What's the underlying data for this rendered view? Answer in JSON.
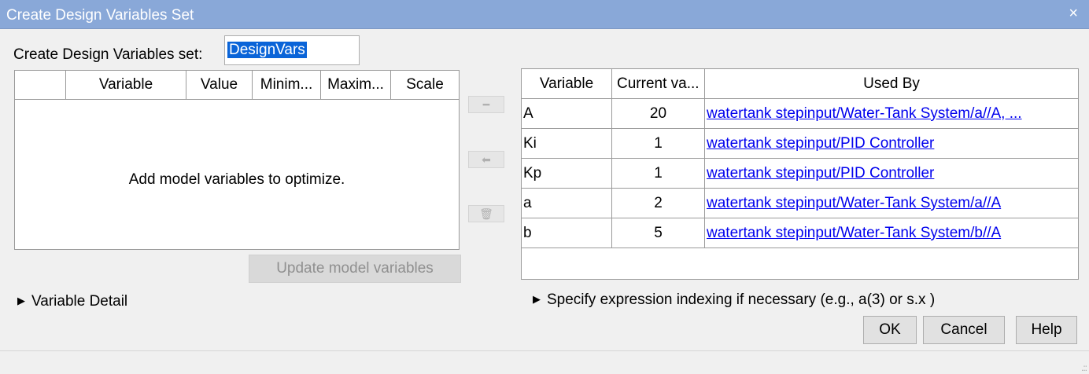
{
  "window": {
    "title": "Create Design Variables Set",
    "close_glyph": "×"
  },
  "name_field": {
    "label": "Create Design Variables set:",
    "value": "DesignVars"
  },
  "left_table": {
    "columns": [
      "",
      "Variable",
      "Value",
      "Minim...",
      "Maxim...",
      "Scale"
    ],
    "empty_message": "Add model variables to optimize."
  },
  "middle_buttons": [
    {
      "icon": "minus-icon",
      "glyph": "━"
    },
    {
      "icon": "arrow-left-icon",
      "glyph": "⬅"
    },
    {
      "icon": "trash-icon",
      "glyph": "🗑"
    }
  ],
  "update_button": "Update model variables",
  "right_table": {
    "columns": [
      "Variable",
      "Current va...",
      "Used By"
    ],
    "rows": [
      {
        "variable": "A",
        "value": "20",
        "used_by": "watertank stepinput/Water-Tank System/a//A, ..."
      },
      {
        "variable": "Ki",
        "value": "1",
        "used_by": "watertank stepinput/PID Controller"
      },
      {
        "variable": "Kp",
        "value": "1",
        "used_by": "watertank stepinput/PID Controller"
      },
      {
        "variable": "a",
        "value": "2",
        "used_by": "watertank stepinput/Water-Tank System/a//A"
      },
      {
        "variable": "b",
        "value": "5",
        "used_by": "watertank stepinput/Water-Tank System/b//A"
      }
    ]
  },
  "variable_detail": "Variable Detail",
  "expression_indexing": "Specify expression indexing if necessary (e.g., a(3) or s.x )",
  "disclosure_glyph": "▶",
  "buttons": {
    "ok": "OK",
    "cancel": "Cancel",
    "help": "Help"
  },
  "resize_grip": ".::",
  "colors": {
    "title_bar": "#89a8d8",
    "selection": "#0a64d8",
    "link": "#0000ee"
  }
}
